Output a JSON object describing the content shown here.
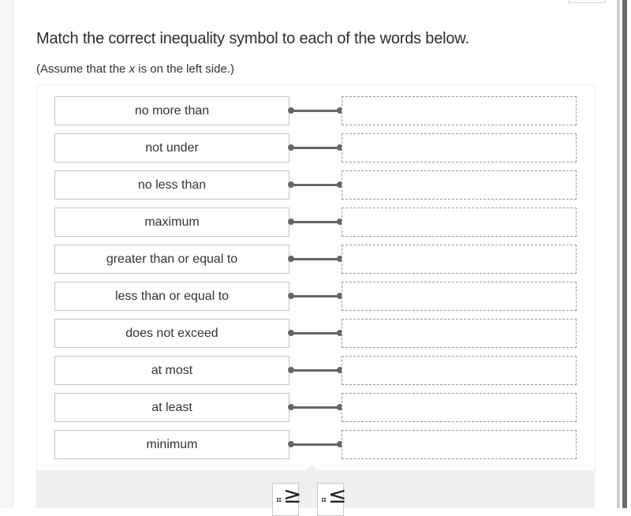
{
  "question": {
    "title": "Match the correct inequality symbol to each of the words below.",
    "subtitle_prefix": "(Assume that the ",
    "subtitle_var": "x",
    "subtitle_suffix": " is on the left side.)"
  },
  "rows": [
    {
      "term": "no more than",
      "answer": ""
    },
    {
      "term": "not under",
      "answer": ""
    },
    {
      "term": "no less than",
      "answer": ""
    },
    {
      "term": "maximum",
      "answer": ""
    },
    {
      "term": "greater than or equal to",
      "answer": ""
    },
    {
      "term": "less than or equal to",
      "answer": ""
    },
    {
      "term": "does not exceed",
      "answer": ""
    },
    {
      "term": "at most",
      "answer": ""
    },
    {
      "term": "at least",
      "answer": ""
    },
    {
      "term": "minimum",
      "answer": ""
    }
  ],
  "choices": [
    {
      "symbol": "≥",
      "icon": "drag-handle-icon"
    },
    {
      "symbol": "≤",
      "icon": "drag-handle-icon"
    }
  ]
}
